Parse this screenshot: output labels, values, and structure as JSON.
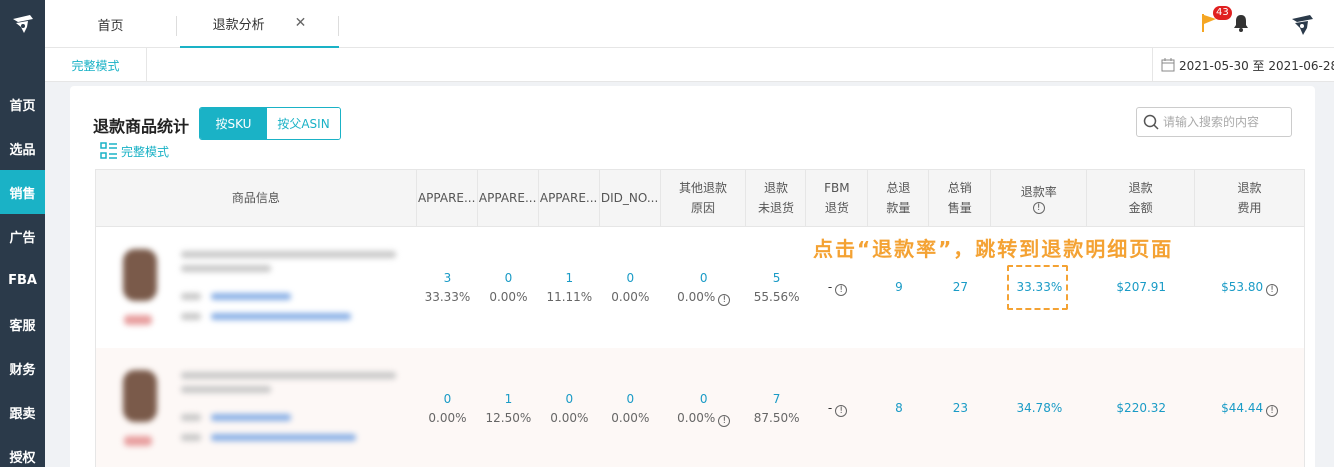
{
  "sidebar": {
    "items": [
      {
        "label": "首页"
      },
      {
        "label": "选品"
      },
      {
        "label": "销售"
      },
      {
        "label": "广告"
      },
      {
        "label": "FBA"
      },
      {
        "label": "客服"
      },
      {
        "label": "财务"
      },
      {
        "label": "跟卖"
      },
      {
        "label": "授权"
      }
    ],
    "active_index": 2
  },
  "tabs": [
    {
      "label": "首页"
    },
    {
      "label": "退款分析",
      "close": "✕"
    }
  ],
  "notifications": {
    "count": "43"
  },
  "subbar": {
    "mode_label": "完整模式",
    "date_range": "2021-05-30 至 2021-06-28"
  },
  "card": {
    "title": "退款商品统计",
    "toggle": {
      "sku": "按SKU",
      "asin": "按父ASIN"
    },
    "full_mode": "完整模式",
    "search_placeholder": "请输入搜索的内容"
  },
  "table": {
    "headers": {
      "product": "商品信息",
      "a1": "APPARE...",
      "a2": "APPARE...",
      "a3": "APPARE...",
      "did": "DID_NO...",
      "other_l1": "其他退款",
      "other_l2": "原因",
      "unret_l1": "退款",
      "unret_l2": "未退货",
      "fbm_l1": "FBM",
      "fbm_l2": "退货",
      "total_ret_l1": "总退",
      "total_ret_l2": "款量",
      "total_sales_l1": "总销",
      "total_sales_l2": "售量",
      "rate_l1": "退款率",
      "amount_l1": "退款",
      "amount_l2": "金额",
      "fee_l1": "退款",
      "fee_l2": "费用"
    },
    "rows": [
      {
        "a1": "3",
        "a1_pct": "33.33%",
        "a2": "0",
        "a2_pct": "0.00%",
        "a3": "1",
        "a3_pct": "11.11%",
        "did": "0",
        "did_pct": "0.00%",
        "other": "0",
        "other_pct": "0.00%",
        "unret": "5",
        "unret_pct": "55.56%",
        "fbm": "-",
        "total_ret": "9",
        "total_sales": "27",
        "rate": "33.33%",
        "amount": "$207.91",
        "fee": "$53.80"
      },
      {
        "a1": "0",
        "a1_pct": "0.00%",
        "a2": "1",
        "a2_pct": "12.50%",
        "a3": "0",
        "a3_pct": "0.00%",
        "did": "0",
        "did_pct": "0.00%",
        "other": "0",
        "other_pct": "0.00%",
        "unret": "7",
        "unret_pct": "87.50%",
        "fbm": "-",
        "total_ret": "8",
        "total_sales": "23",
        "rate": "34.78%",
        "amount": "$220.32",
        "fee": "$44.44"
      }
    ]
  },
  "annotation": {
    "text": "点击“退款率”，跳转到退款明细页面"
  },
  "colors": {
    "accent": "#1ab2c6",
    "sidebar": "#2b3a4a",
    "annotation": "#f4a233",
    "link": "#1a9bc6"
  },
  "icons": [
    "logo-icon",
    "flag-icon",
    "bell-icon",
    "avatar-icon",
    "calendar-icon",
    "search-icon",
    "list-mode-icon",
    "info-icon",
    "close-icon"
  ]
}
